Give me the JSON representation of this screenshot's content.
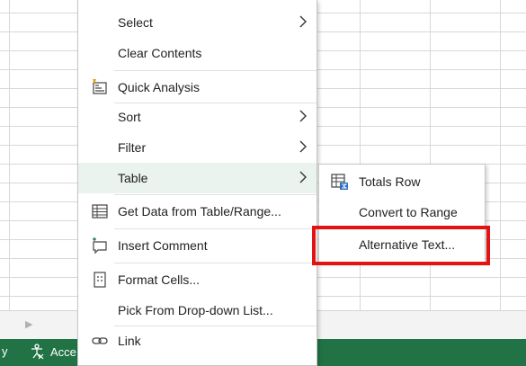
{
  "menu": {
    "items": [
      {
        "label": "Select",
        "icon": "",
        "has_submenu": true
      },
      {
        "label": "Clear Contents",
        "icon": "",
        "has_submenu": false
      },
      {
        "label": "Quick Analysis",
        "icon": "quick-analysis-icon",
        "has_submenu": false
      },
      {
        "label": "Sort",
        "icon": "",
        "has_submenu": true
      },
      {
        "label": "Filter",
        "icon": "",
        "has_submenu": true
      },
      {
        "label": "Table",
        "icon": "",
        "has_submenu": true,
        "active": true
      },
      {
        "label": "Get Data from Table/Range...",
        "icon": "table-data-icon",
        "has_submenu": false
      },
      {
        "label": "Insert Comment",
        "icon": "comment-icon",
        "has_submenu": false
      },
      {
        "label": "Format Cells...",
        "icon": "format-cells-icon",
        "has_submenu": false
      },
      {
        "label": "Pick From Drop-down List...",
        "icon": "",
        "has_submenu": false
      },
      {
        "label": "Link",
        "icon": "link-icon",
        "has_submenu": false
      }
    ]
  },
  "submenu": {
    "items": [
      {
        "label": "Totals Row",
        "icon": "totals-row-icon"
      },
      {
        "label": "Convert to Range",
        "icon": ""
      },
      {
        "label": "Alternative Text...",
        "icon": "",
        "highlighted": true
      }
    ]
  },
  "status_bar": {
    "left_glyph": "y",
    "accessibility_label": "Acce"
  },
  "colors": {
    "status_bar": "#217346",
    "highlight_box": "#e21313",
    "active_item_bg": "#eaf3ee"
  }
}
